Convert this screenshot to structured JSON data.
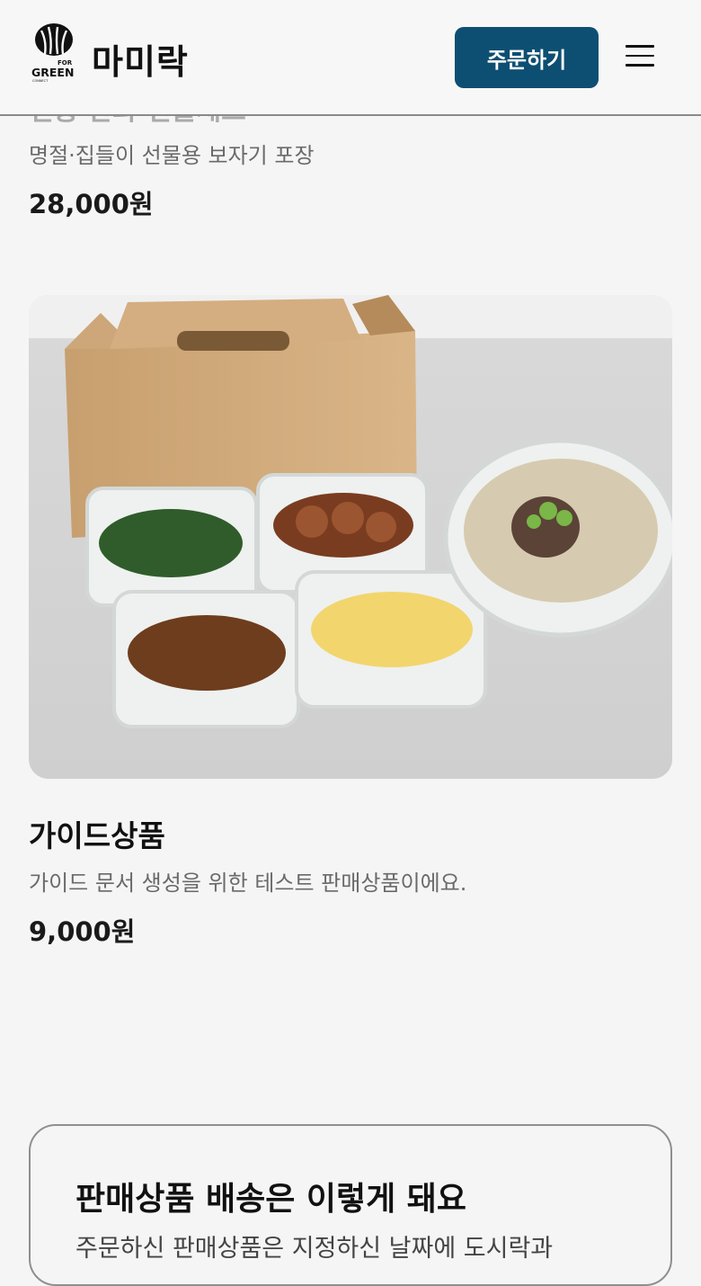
{
  "header": {
    "logo_text_top": "FOR",
    "logo_text_main": "GREEN",
    "logo_text_small": "CONNECT",
    "brand": "마미락",
    "order_button": "주문하기",
    "menu_icon": "hamburger-icon"
  },
  "products": [
    {
      "title_partial": "전통 한과 선물세트",
      "description": "명절·집들이 선물용 보자기 포장",
      "price": "28,000원"
    },
    {
      "title": "가이드상품",
      "description": "가이드 문서 생성을 위한 테스트 판매상품이에요.",
      "price": "9,000원"
    }
  ],
  "shipping_info": {
    "title": "판매상품 배송은 이렇게 돼요",
    "body": "주문하신 판매상품은 지정하신 날짜에 도시락과"
  }
}
